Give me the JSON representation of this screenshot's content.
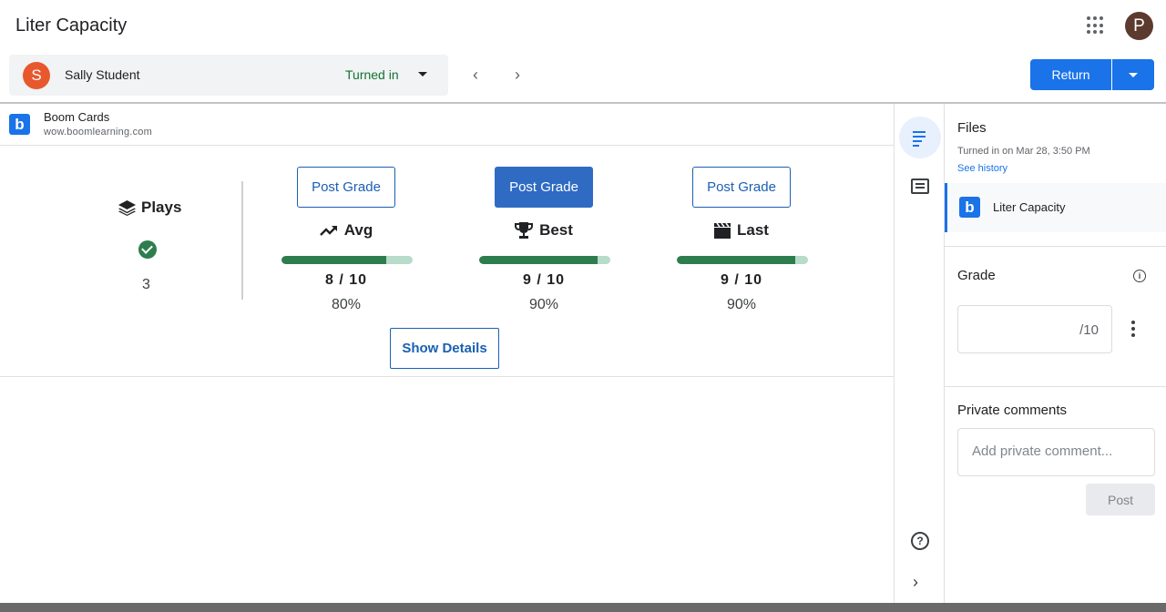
{
  "header": {
    "title": "Liter Capacity",
    "user_initial": "P"
  },
  "student_bar": {
    "initial": "S",
    "name": "Sally Student",
    "status": "Turned in"
  },
  "actions": {
    "return_label": "Return"
  },
  "attachment": {
    "logo_letter": "b",
    "title": "Boom Cards",
    "url": "wow.boomlearning.com"
  },
  "plays": {
    "label": "Plays",
    "count": "3"
  },
  "stats": [
    {
      "button": "Post Grade",
      "label": "Avg",
      "score": "8 / 10",
      "percent": "80%",
      "fill": 0.8
    },
    {
      "button": "Post Grade",
      "label": "Best",
      "score": "9 / 10",
      "percent": "90%",
      "fill": 0.9
    },
    {
      "button": "Post Grade",
      "label": "Last",
      "score": "9 / 10",
      "percent": "90%",
      "fill": 0.9
    }
  ],
  "show_details_label": "Show Details",
  "side_panel": {
    "files_title": "Files",
    "turned_in_text": "Turned in on Mar 28, 3:50 PM",
    "see_history": "See history",
    "file_name": "Liter Capacity",
    "grade_title": "Grade",
    "grade_denominator": "/10",
    "comments_title": "Private comments",
    "comment_placeholder": "Add private comment...",
    "post_label": "Post"
  },
  "colors": {
    "primary": "#1a73e8",
    "success": "#137333",
    "bar_fill": "#2e7d4f",
    "bar_track": "#b7dcc9"
  }
}
